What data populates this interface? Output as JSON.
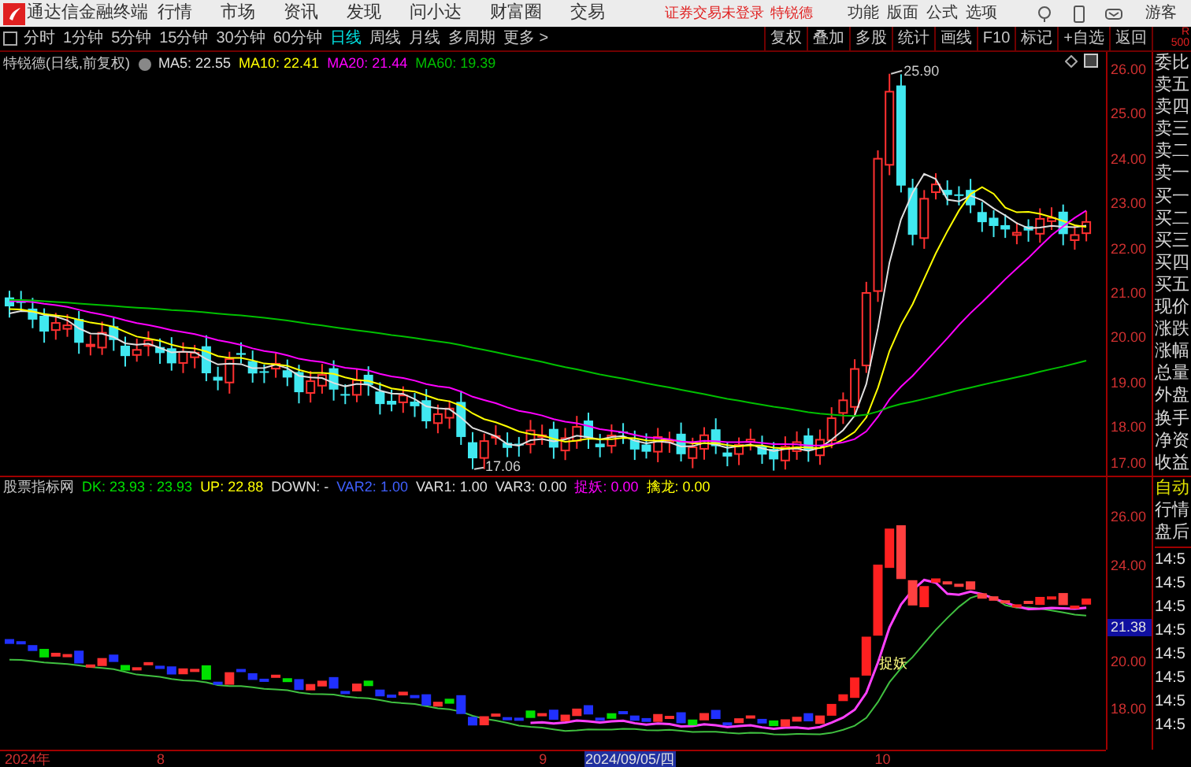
{
  "app": {
    "title": "通达信金融终端",
    "menu": [
      "行情",
      "市场",
      "资讯",
      "发现",
      "问小达",
      "财富圈",
      "交易"
    ],
    "login_status": "证券交易未登录",
    "stock_name": "特锐德",
    "right_menu": [
      "功能",
      "版面",
      "公式",
      "选项"
    ],
    "user": "游客"
  },
  "period_tabs": [
    {
      "label": "分时",
      "selected": false
    },
    {
      "label": "1分钟",
      "selected": false
    },
    {
      "label": "5分钟",
      "selected": false
    },
    {
      "label": "15分钟",
      "selected": false
    },
    {
      "label": "30分钟",
      "selected": false
    },
    {
      "label": "60分钟",
      "selected": false
    },
    {
      "label": "日线",
      "selected": true
    },
    {
      "label": "周线",
      "selected": false
    },
    {
      "label": "月线",
      "selected": false
    },
    {
      "label": "多周期",
      "selected": false
    },
    {
      "label": "更多 >",
      "selected": false
    }
  ],
  "tool_buttons": [
    "复权",
    "叠加",
    "多股",
    "统计",
    "画线",
    "F10",
    "标记",
    "+自选",
    "返回"
  ],
  "corner_badge": [
    "R",
    "500"
  ],
  "price_chart": {
    "title": "特锐德(日线,前复权)",
    "ma": [
      {
        "label": "MA5: 22.55",
        "color": "#e0e0e0"
      },
      {
        "label": "MA10: 22.41",
        "color": "#ffff00"
      },
      {
        "label": "MA20: 21.44",
        "color": "#ff00ff"
      },
      {
        "label": "MA60: 19.39",
        "color": "#00c000"
      }
    ],
    "high_label": "25.90",
    "low_label": "17.06",
    "y_labels": [
      "26.00",
      "25.00",
      "24.00",
      "23.00",
      "22.00",
      "21.00",
      "20.00",
      "19.00",
      "18.00",
      "17.00"
    ]
  },
  "indicator_chart": {
    "title": "股票指标网",
    "values": [
      {
        "label": "DK: 23.93 : 23.93",
        "color": "#00e000"
      },
      {
        "label": "UP: 22.88",
        "color": "#ffff00"
      },
      {
        "label": "DOWN: -",
        "color": "#e0e0e0"
      },
      {
        "label": "VAR2: 1.00",
        "color": "#4060ff"
      },
      {
        "label": "VAR1: 1.00",
        "color": "#e0e0e0"
      },
      {
        "label": "VAR3: 0.00",
        "color": "#e0e0e0"
      },
      {
        "label": "捉妖: 0.00",
        "color": "#ff00ff"
      },
      {
        "label": "擒龙: 0.00",
        "color": "#ffff00"
      }
    ],
    "signal_label": "捉妖",
    "y_labels": [
      "26.00",
      "24.00",
      "20.00",
      "18.00"
    ],
    "current_value": "21.38"
  },
  "date_axis": [
    {
      "label": "2024年",
      "selected": false
    },
    {
      "label": "8",
      "selected": false
    },
    {
      "label": "9",
      "selected": false
    },
    {
      "label": "2024/09/05/四",
      "selected": true
    },
    {
      "label": "10",
      "selected": false
    }
  ],
  "quote_panel": [
    "委比",
    "卖五",
    "卖四",
    "卖三",
    "卖二",
    "卖一",
    "买一",
    "买二",
    "买三",
    "买四",
    "买五",
    "现价",
    "涨跌",
    "涨幅",
    "总量",
    "外盘",
    "换手",
    "净资",
    "收益"
  ],
  "trade_panel": {
    "mode": "自动",
    "items": [
      "行情",
      "盘后"
    ],
    "times": [
      "14:5",
      "14:5",
      "14:5",
      "14:5",
      "14:5",
      "14:5",
      "14:5",
      "14:5"
    ]
  }
}
